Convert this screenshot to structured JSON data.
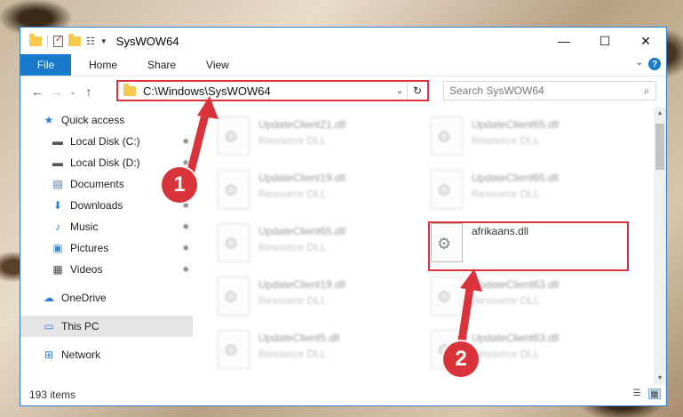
{
  "window": {
    "title": "SysWOW64",
    "controls": {
      "minimize": "—",
      "maximize": "☐",
      "close": "✕"
    }
  },
  "ribbon": {
    "file": "File",
    "tabs": [
      "Home",
      "Share",
      "View"
    ],
    "help": "?"
  },
  "navigation": {
    "back": "←",
    "forward": "→",
    "recent": "⌄",
    "up": "↑",
    "address": "C:\\Windows\\SysWOW64",
    "refresh": "↻",
    "search_placeholder": "Search SysWOW64",
    "search_icon": "⌕"
  },
  "sidebar": {
    "items": [
      {
        "label": "Quick access",
        "icon": "star-icon",
        "glyph": "★",
        "color": "#2d7fd6",
        "pinned": false
      },
      {
        "label": "Local Disk (C:)",
        "icon": "drive-icon",
        "glyph": "▬",
        "color": "#555555",
        "pinned": true
      },
      {
        "label": "Local Disk (D:)",
        "icon": "drive-icon",
        "glyph": "▬",
        "color": "#555555",
        "pinned": true
      },
      {
        "label": "Documents",
        "icon": "documents-icon",
        "glyph": "▤",
        "color": "#4a6fa5",
        "pinned": true
      },
      {
        "label": "Downloads",
        "icon": "downloads-icon",
        "glyph": "⬇",
        "color": "#2d7fd6",
        "pinned": true
      },
      {
        "label": "Music",
        "icon": "music-icon",
        "glyph": "♪",
        "color": "#2d7fd6",
        "pinned": true
      },
      {
        "label": "Pictures",
        "icon": "pictures-icon",
        "glyph": "▣",
        "color": "#3b8ad8",
        "pinned": true
      },
      {
        "label": "Videos",
        "icon": "videos-icon",
        "glyph": "▦",
        "color": "#444444",
        "pinned": true
      },
      {
        "label": "OneDrive",
        "icon": "onedrive-icon",
        "glyph": "☁",
        "color": "#2d7fd6",
        "pinned": false
      },
      {
        "label": "This PC",
        "icon": "computer-icon",
        "glyph": "▭",
        "color": "#2d7fd6",
        "pinned": false,
        "selected": true
      },
      {
        "label": "Network",
        "icon": "network-icon",
        "glyph": "⊞",
        "color": "#2d7fd6",
        "pinned": false
      }
    ],
    "pin_glyph": "📌"
  },
  "files": [
    {
      "name": "UpdateClient21.dll",
      "type": "Resource DLL",
      "blurred": true
    },
    {
      "name": "UpdateClient65.dll",
      "type": "Resource DLL",
      "blurred": true
    },
    {
      "name": "UpdateClient19.dll",
      "type": "Resource DLL",
      "blurred": true
    },
    {
      "name": "UpdateClient65.dll",
      "type": "Resource DLL",
      "blurred": true
    },
    {
      "name": "UpdateClient65.dll",
      "type": "Resource DLL",
      "blurred": true
    },
    {
      "name": "afrikaans.dll",
      "type": "",
      "blurred": false,
      "highlighted": true
    },
    {
      "name": "UpdateClient19.dll",
      "type": "Resource DLL",
      "blurred": true
    },
    {
      "name": "UpdateClient63.dll",
      "type": "Resource DLL",
      "blurred": true
    },
    {
      "name": "UpdateClient5.dll",
      "type": "Resource DLL",
      "blurred": true
    },
    {
      "name": "UpdateClient63.dll",
      "type": "Resource DLL",
      "blurred": true
    }
  ],
  "status": {
    "item_count": "193 items"
  },
  "annotations": {
    "step1": "1",
    "step2": "2",
    "color": "#d9343c"
  }
}
